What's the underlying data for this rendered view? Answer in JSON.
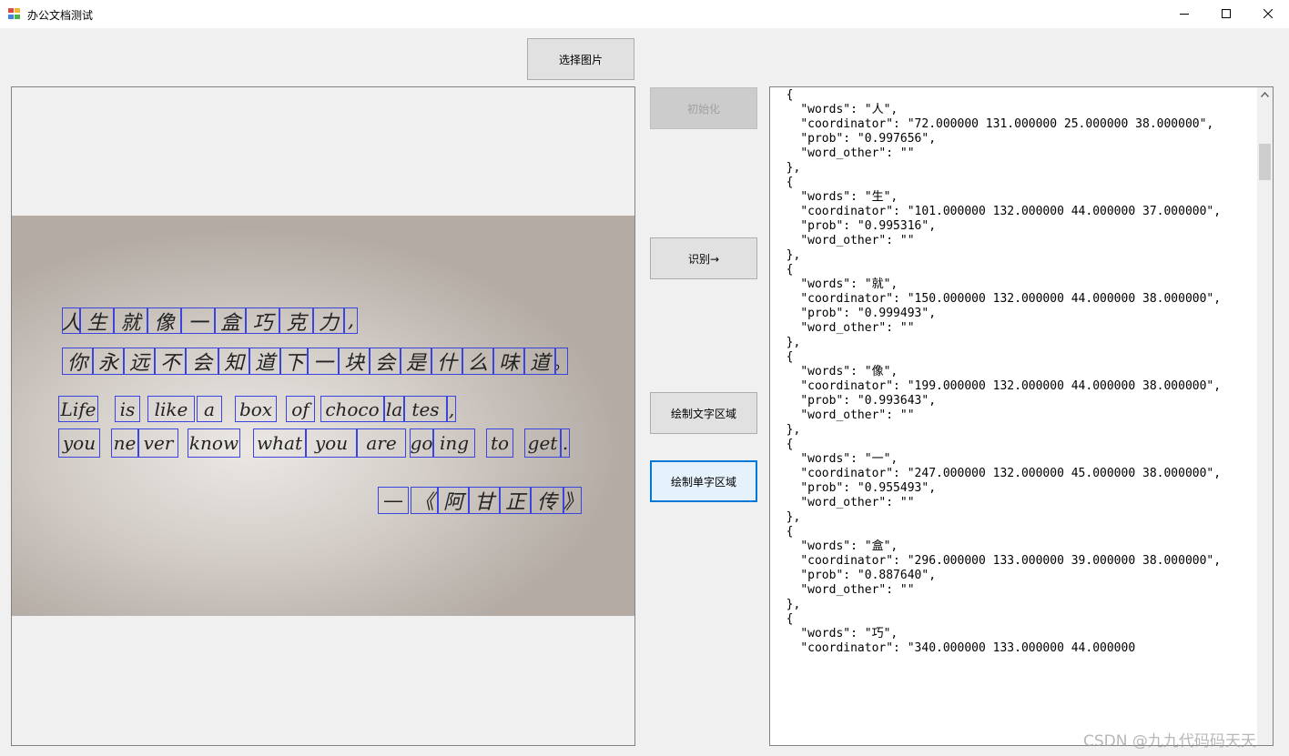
{
  "window": {
    "title": "办公文档测试",
    "controls": {
      "minimize": "minimize-icon",
      "maximize": "maximize-icon",
      "close": "close-icon"
    }
  },
  "buttons": {
    "select_image": "选择图片",
    "init": "初始化",
    "recognize": "识别→",
    "draw_text_region": "绘制文字区域",
    "draw_char_region": "绘制单字区域"
  },
  "photo_text": {
    "line1": [
      "人",
      "生",
      "就",
      "像",
      "一",
      "盒",
      "巧",
      "克",
      "力",
      ","
    ],
    "line2": [
      "你",
      "永",
      "远",
      "不",
      "会",
      "知",
      "道",
      "下",
      "一",
      "块",
      "会",
      "是",
      "什",
      "么",
      "味",
      "道",
      "。"
    ],
    "line3": [
      "Life",
      "is",
      "like",
      "a",
      "box",
      "of",
      "choco",
      "la",
      "tes",
      ","
    ],
    "line4": [
      "you",
      "ne",
      "ver",
      "know",
      "what",
      "you",
      "are",
      "go",
      "ing",
      "to",
      "get",
      "."
    ],
    "line5": [
      "—",
      "《",
      "阿",
      "甘",
      "正",
      "传",
      "》"
    ]
  },
  "result_text": "  {\n    \"words\": \"人\",\n    \"coordinator\": \"72.000000 131.000000 25.000000 38.000000\",\n    \"prob\": \"0.997656\",\n    \"word_other\": \"\"\n  },\n  {\n    \"words\": \"生\",\n    \"coordinator\": \"101.000000 132.000000 44.000000 37.000000\",\n    \"prob\": \"0.995316\",\n    \"word_other\": \"\"\n  },\n  {\n    \"words\": \"就\",\n    \"coordinator\": \"150.000000 132.000000 44.000000 38.000000\",\n    \"prob\": \"0.999493\",\n    \"word_other\": \"\"\n  },\n  {\n    \"words\": \"像\",\n    \"coordinator\": \"199.000000 132.000000 44.000000 38.000000\",\n    \"prob\": \"0.993643\",\n    \"word_other\": \"\"\n  },\n  {\n    \"words\": \"一\",\n    \"coordinator\": \"247.000000 132.000000 45.000000 38.000000\",\n    \"prob\": \"0.955493\",\n    \"word_other\": \"\"\n  },\n  {\n    \"words\": \"盒\",\n    \"coordinator\": \"296.000000 133.000000 39.000000 38.000000\",\n    \"prob\": \"0.887640\",\n    \"word_other\": \"\"\n  },\n  {\n    \"words\": \"巧\",\n    \"coordinator\": \"340.000000 133.000000 44.000000",
  "watermark": "CSDN @九九代码码天天",
  "colors": {
    "box_outline": "#3a44e0",
    "focus": "#0078d7"
  }
}
